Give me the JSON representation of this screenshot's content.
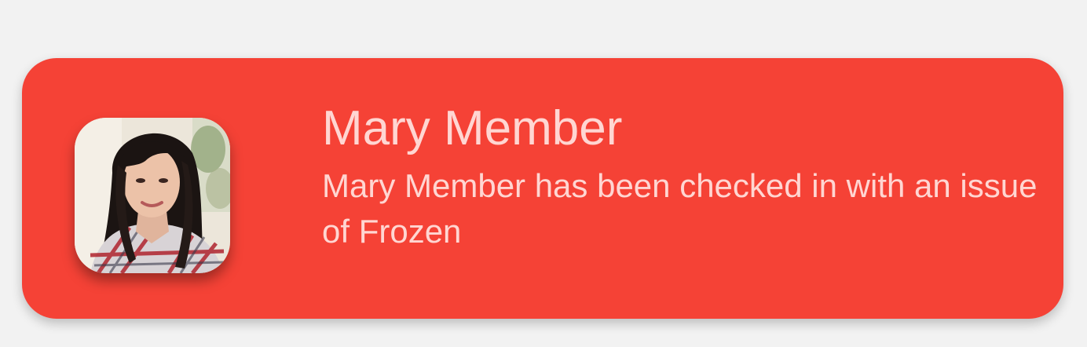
{
  "notification": {
    "title": "Mary Member",
    "message": "Mary Member has been checked in with an issue of Frozen",
    "avatar_icon": "user-photo",
    "colors": {
      "background": "#f54236",
      "text": "#ffd6d2",
      "page_background": "#f2f2f2"
    }
  }
}
